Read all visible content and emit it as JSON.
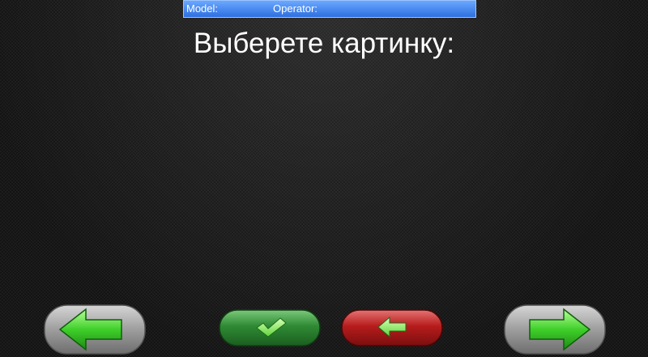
{
  "status_bar": {
    "model_label": "Model:",
    "operator_label": "Operator:",
    "bg_color": "#2f6fe0"
  },
  "title": "Выберете картинку:",
  "buttons": {
    "prev": {
      "icon": "arrow-left-icon",
      "color": "#9a9a9a"
    },
    "confirm": {
      "icon": "checkmark-icon",
      "color": "#2e7d32"
    },
    "back": {
      "icon": "arrow-back-icon",
      "color": "#b71c1c"
    },
    "next": {
      "icon": "arrow-right-icon",
      "color": "#9a9a9a"
    }
  }
}
